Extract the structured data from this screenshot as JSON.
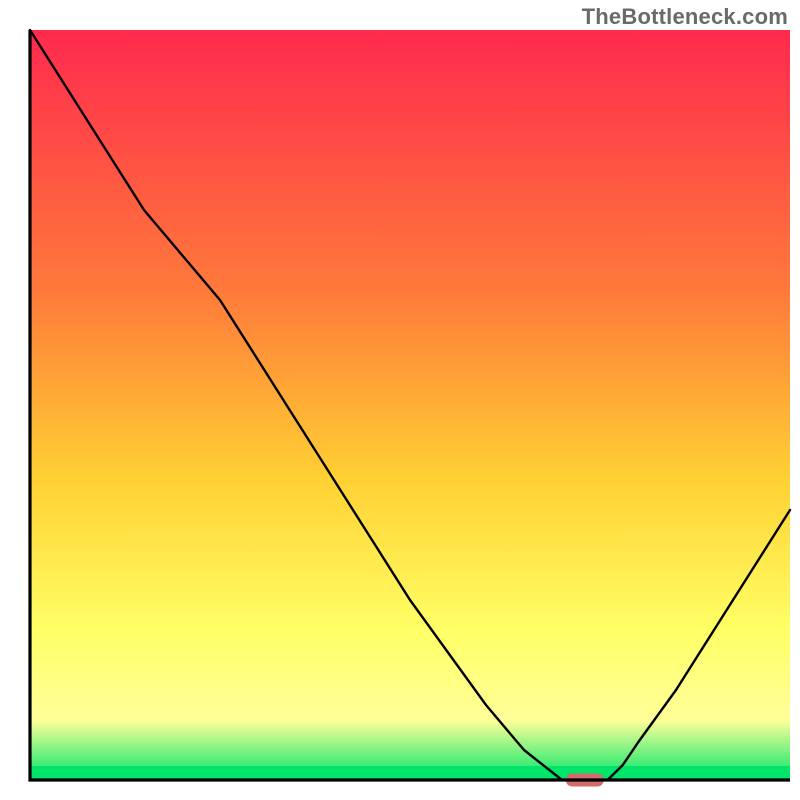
{
  "watermark": "TheBottleneck.com",
  "colors": {
    "gradient_top": "#ff2a4e",
    "gradient_mid1": "#ff7a3a",
    "gradient_mid2": "#ffd133",
    "gradient_mid3": "#ffff66",
    "gradient_mid4": "#ffff99",
    "gradient_bottom": "#00e56a",
    "axis": "#000000",
    "curve": "#000000",
    "marker_fill": "#d46a6a",
    "marker_stroke": "#b84d4d"
  },
  "chart_data": {
    "type": "line",
    "title": "",
    "xlabel": "",
    "ylabel": "",
    "x": [
      0.0,
      0.05,
      0.1,
      0.15,
      0.2,
      0.25,
      0.3,
      0.35,
      0.4,
      0.45,
      0.5,
      0.55,
      0.6,
      0.65,
      0.7,
      0.72,
      0.74,
      0.76,
      0.78,
      0.8,
      0.85,
      0.9,
      0.95,
      1.0
    ],
    "values": [
      1.0,
      0.92,
      0.84,
      0.76,
      0.7,
      0.64,
      0.56,
      0.48,
      0.4,
      0.32,
      0.24,
      0.17,
      0.1,
      0.04,
      0.0,
      0.0,
      0.0,
      0.0,
      0.02,
      0.05,
      0.12,
      0.2,
      0.28,
      0.36
    ],
    "xlim": [
      0,
      1
    ],
    "ylim": [
      0,
      1
    ],
    "marker": {
      "x_start": 0.705,
      "x_end": 0.755,
      "y": 0.0
    },
    "notes": "x is normalized horizontal position across the plot; values are the normalized height of the black curve (0 = bottom axis, 1 = top of plot). Curve descends from top-left, flattens near x≈0.70–0.76, then rises toward the right. A small rounded marker sits on the axis at the curve minimum."
  }
}
